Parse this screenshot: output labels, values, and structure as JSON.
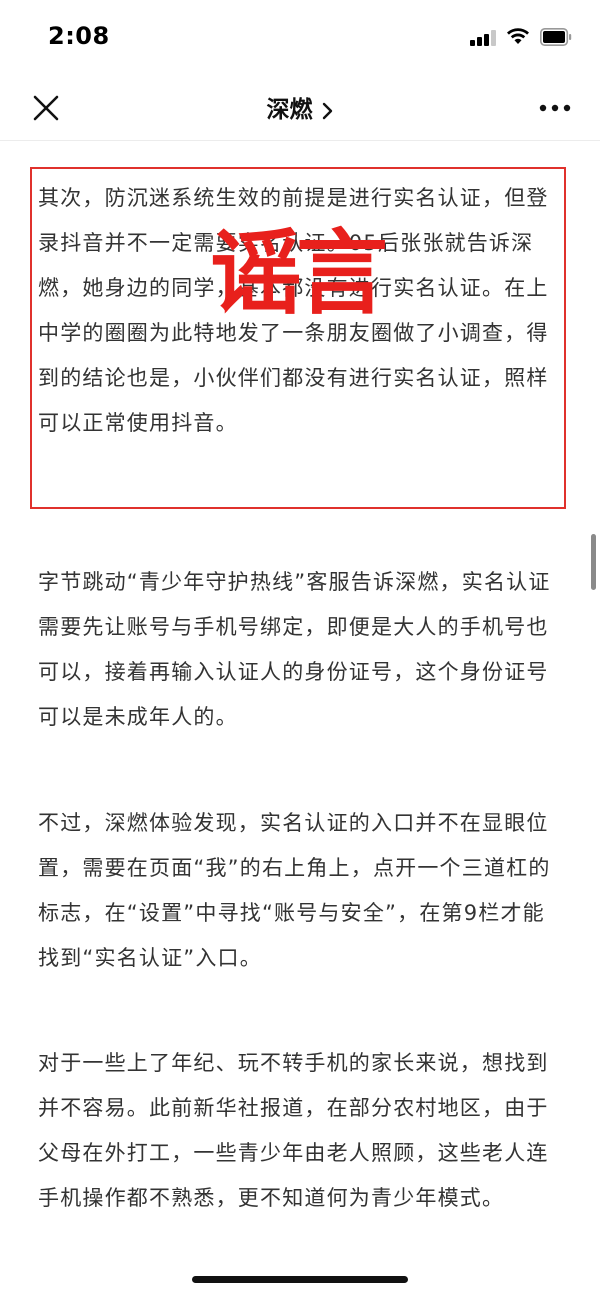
{
  "status_bar": {
    "time": "2:08"
  },
  "nav": {
    "title": "深燃",
    "chevron": ">"
  },
  "stamp": {
    "text": "谣言",
    "color": "#e8201c"
  },
  "article": {
    "paragraphs": [
      "其次，防沉迷系统生效的前提是进行实名认证，但登录抖音并不一定需要实名认证。05后张张就告诉深燃，她身边的同学，基本都没有进行实名认证。在上中学的圈圈为此特地发了一条朋友圈做了小调查，得到的结论也是，小伙伴们都没有进行实名认证，照样可以正常使用抖音。",
      "字节跳动“青少年守护热线”客服告诉深燃，实名认证需要先让账号与手机号绑定，即便是大人的手机号也可以，接着再输入认证人的身份证号，这个身份证号可以是未成年人的。",
      "不过，深燃体验发现，实名认证的入口并不在显眼位置，需要在页面“我”的右上角上，点开一个三道杠的标志，在“设置”中寻找“账号与安全”，在第9栏才能找到“实名认证”入口。",
      "对于一些上了年纪、玩不转手机的家长来说，想找到并不容易。此前新华社报道，在部分农村地区，由于父母在外打工，一些青少年由老人照顾，这些老人连手机操作都不熟悉，更不知道何为青少年模式。"
    ]
  },
  "colors": {
    "accent_red": "#e0312c",
    "text": "#333333"
  }
}
